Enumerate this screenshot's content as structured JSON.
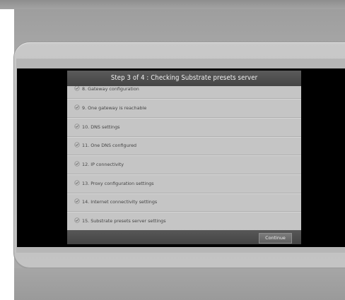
{
  "dialog": {
    "title": "Step 3 of 4 : Checking Substrate presets server",
    "steps": [
      {
        "label": "8. Gateway configuration",
        "status_icon": "check-icon"
      },
      {
        "label": "9. One gateway is reachable",
        "status_icon": "check-icon"
      },
      {
        "label": "10. DNS settings",
        "status_icon": "check-icon"
      },
      {
        "label": "11. One DNS configured",
        "status_icon": "check-icon"
      },
      {
        "label": "12. IP connectivity",
        "status_icon": "check-icon"
      },
      {
        "label": "13. Proxy configuration settings",
        "status_icon": "check-icon"
      },
      {
        "label": "14. Internet connectivity settings",
        "status_icon": "check-icon"
      },
      {
        "label": "15. Substrate presets server settings",
        "status_icon": "check-icon"
      }
    ],
    "continue_label": "Continue"
  },
  "colors": {
    "header_bg": "#4f4f4f",
    "dialog_bg": "#c5c5c5",
    "text": "#454545",
    "screen_bg": "#000000"
  }
}
